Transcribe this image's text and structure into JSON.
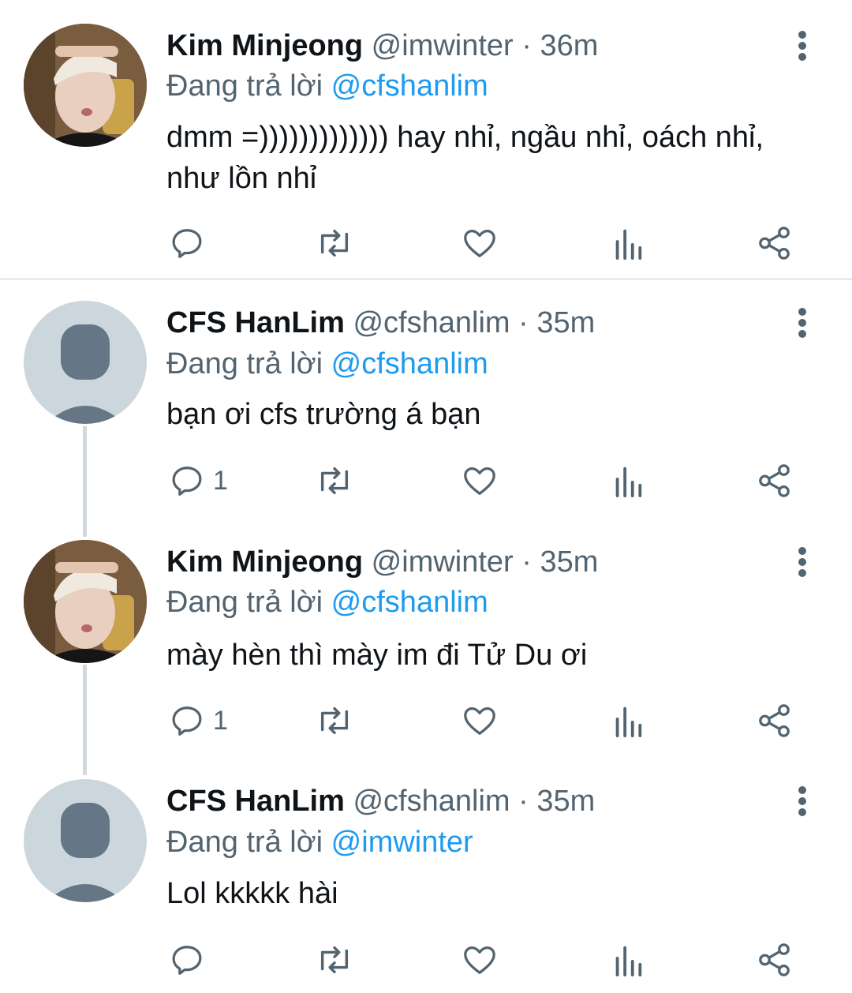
{
  "reply_prefix": "Đang trả lời",
  "tweets": [
    {
      "name": "Kim Minjeong",
      "handle": "@imwinter",
      "dot": "·",
      "time": "36m",
      "reply_to": "@cfshanlim",
      "text": "dmm =))))))))))))) hay nhỉ, ngầu nhỉ, oách nhỉ, như lồn nhỉ",
      "reply_count": "",
      "avatar": "photo"
    },
    {
      "name": "CFS HanLim",
      "handle": "@cfshanlim",
      "dot": "·",
      "time": "35m",
      "reply_to": "@cfshanlim",
      "text": "bạn ơi cfs trường á bạn",
      "reply_count": "1",
      "avatar": "default"
    },
    {
      "name": "Kim Minjeong",
      "handle": "@imwinter",
      "dot": "·",
      "time": "35m",
      "reply_to": "@cfshanlim",
      "text": "mày hèn thì mày im đi Tử Du ơi",
      "reply_count": "1",
      "avatar": "photo"
    },
    {
      "name": "CFS HanLim",
      "handle": "@cfshanlim",
      "dot": "·",
      "time": "35m",
      "reply_to": "@imwinter",
      "text": "Lol kkkkk hài",
      "reply_count": "",
      "avatar": "default"
    }
  ],
  "icons": {
    "reply": "speech-bubble-icon",
    "retweet": "retweet-icon",
    "like": "heart-icon",
    "analytics": "bar-chart-icon",
    "share": "share-icon",
    "more": "vertical-dots-icon"
  },
  "colors": {
    "text": "#0f1419",
    "secondary": "#536471",
    "link": "#1d9bf0",
    "avatar_default": "#ccd6dd",
    "avatar_silhouette": "#657786"
  }
}
